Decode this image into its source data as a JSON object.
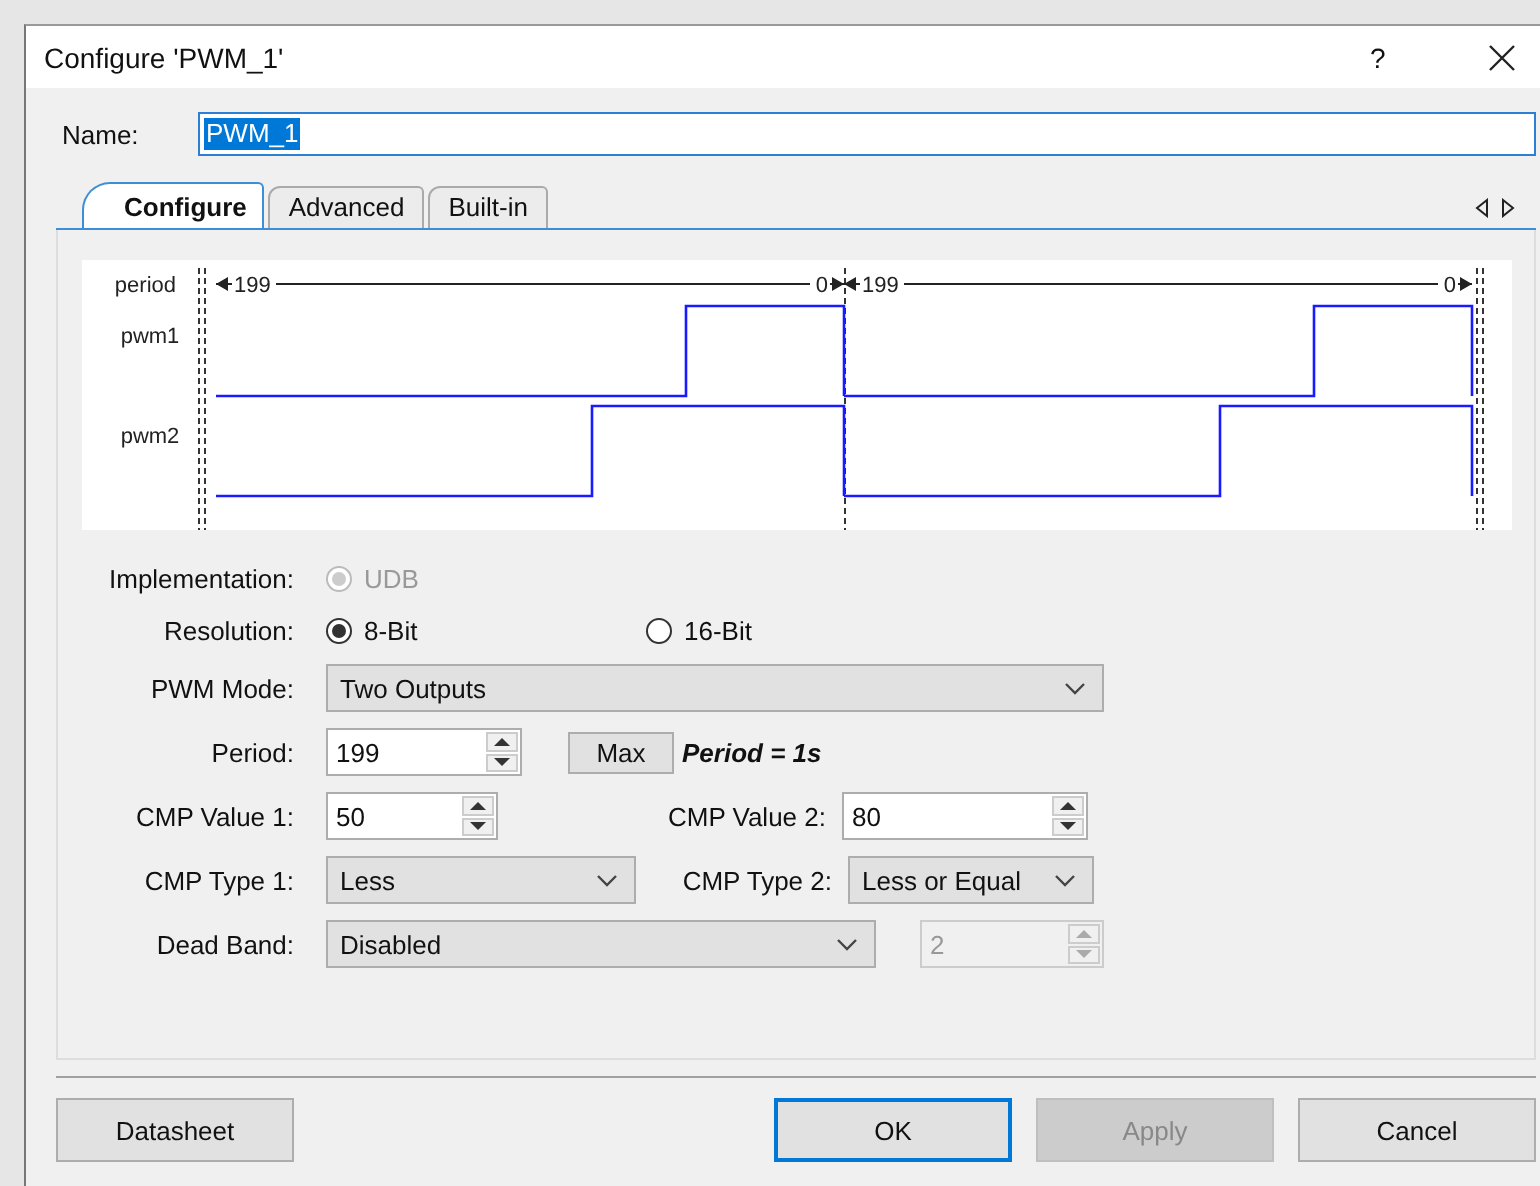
{
  "window": {
    "title": "Configure 'PWM_1'",
    "help": "?"
  },
  "name_field": {
    "label": "Name:",
    "value": "PWM_1",
    "text_selected": true
  },
  "tabs": [
    {
      "label": "Configure",
      "selected": true
    },
    {
      "label": "Advanced",
      "selected": false
    },
    {
      "label": "Built-in",
      "selected": false
    }
  ],
  "timing_diagram": {
    "period": {
      "label": "period",
      "markers": [
        {
          "start": "199",
          "end": "0"
        },
        {
          "start": "199",
          "end": "0"
        }
      ]
    },
    "signals": [
      {
        "name": "pwm1"
      },
      {
        "name": "pwm2"
      }
    ]
  },
  "implementation": {
    "label": "Implementation:",
    "options": [
      {
        "label": "UDB",
        "selected": true,
        "disabled": true
      }
    ]
  },
  "resolution": {
    "label": "Resolution:",
    "options": [
      {
        "label": "8-Bit",
        "selected": true,
        "disabled": false
      },
      {
        "label": "16-Bit",
        "selected": false,
        "disabled": false
      }
    ]
  },
  "pwm_mode": {
    "label": "PWM Mode:",
    "value": "Two Outputs"
  },
  "period": {
    "label": "Period:",
    "value": "199",
    "button": "Max",
    "note": "Period = 1s"
  },
  "cmp_values": [
    {
      "label": "CMP Value 1:",
      "value": "50"
    },
    {
      "label": "CMP Value 2:",
      "value": "80"
    }
  ],
  "cmp_types": [
    {
      "label": "CMP Type 1:",
      "value": "Less"
    },
    {
      "label": "CMP Type 2:",
      "value": "Less or Equal"
    }
  ],
  "dead_band": {
    "label": "Dead Band:",
    "value": "Disabled",
    "count": {
      "value": "2",
      "disabled": true
    }
  },
  "buttons": [
    {
      "label": "Datasheet",
      "default": false,
      "disabled": false
    },
    {
      "label": "OK",
      "default": true,
      "disabled": false
    },
    {
      "label": "Apply",
      "default": false,
      "disabled": true
    },
    {
      "label": "Cancel",
      "default": false,
      "disabled": false
    }
  ]
}
